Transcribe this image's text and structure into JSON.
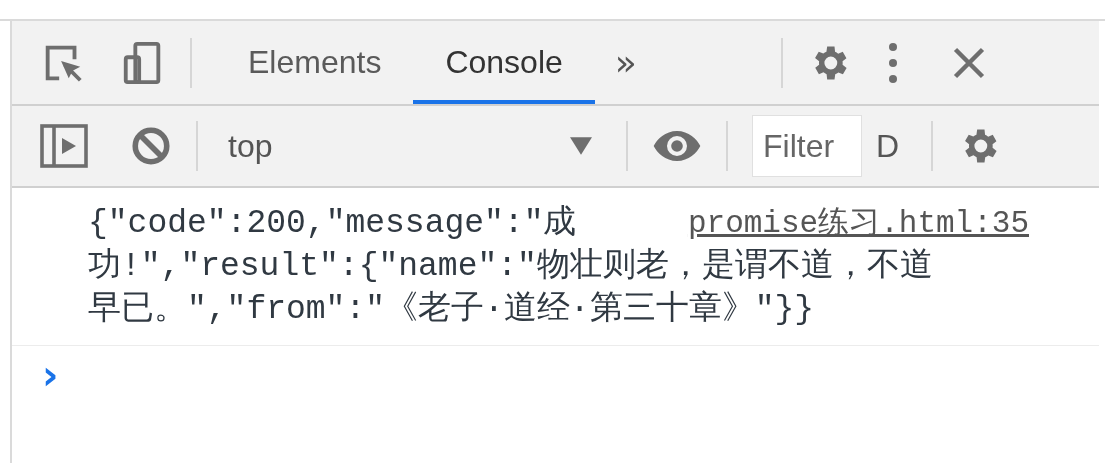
{
  "tabs": [
    {
      "label": "Elements",
      "selected": false
    },
    {
      "label": "Console",
      "selected": true
    }
  ],
  "more_tabs": "»",
  "console_toolbar": {
    "context": "top",
    "filter": {
      "placeholder": "Filter"
    },
    "levels": "D"
  },
  "messages": [
    {
      "lines": [
        "{\"code\":200,\"message\":\"成",
        "功!\",\"result\":{\"name\":\"物壮则老，是谓不道，不道",
        "早已。\",\"from\":\"《老子·道经·第三十章》\"}}"
      ],
      "source": "promise练习.html:35"
    }
  ],
  "prompt": "›"
}
